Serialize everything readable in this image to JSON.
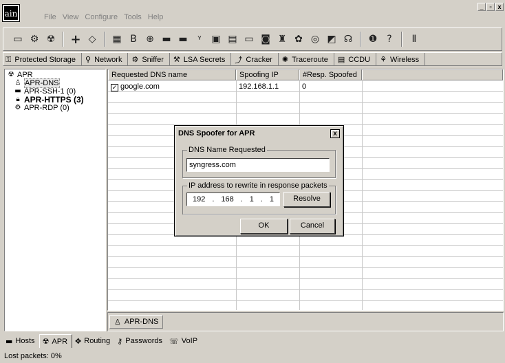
{
  "app": {
    "logo_text": "ain"
  },
  "menu": [
    "File",
    "View",
    "Configure",
    "Tools",
    "Help"
  ],
  "window_controls": [
    "_",
    "▫",
    "x"
  ],
  "toolbar": {
    "icons": [
      "open-icon",
      "sniffer-icon",
      "apr-icon",
      "add-icon",
      "hash-icon",
      "config-icon",
      "base64-icon",
      "dump-icon",
      "lsa-icon",
      "wireless-icon",
      "pwd-icon",
      "rsa-icon",
      "ntlm-icon",
      "keyboard-icon",
      "cd-icon",
      "vnc-icon",
      "dict-icon",
      "route-icon",
      "voip-icon",
      "about-icon",
      "help-icon",
      "exit-icon"
    ]
  },
  "tabs": [
    {
      "label": "Protected Storage",
      "icon": "vault-icon"
    },
    {
      "label": "Network",
      "icon": "network-icon"
    },
    {
      "label": "Sniffer",
      "icon": "sniffer-icon"
    },
    {
      "label": "LSA Secrets",
      "icon": "lsa-icon"
    },
    {
      "label": "Cracker",
      "icon": "cracker-icon"
    },
    {
      "label": "Traceroute",
      "icon": "traceroute-icon"
    },
    {
      "label": "CCDU",
      "icon": "ccdu-icon"
    },
    {
      "label": "Wireless",
      "icon": "wireless-icon"
    }
  ],
  "tree": {
    "root": "APR",
    "items": [
      {
        "label": "APR-DNS",
        "icon": "dns-icon"
      },
      {
        "label": "APR-SSH-1 (0)",
        "icon": "terminal-icon"
      },
      {
        "label": "APR-HTTPS (3)",
        "icon": "lock-icon"
      },
      {
        "label": "APR-RDP (0)",
        "icon": "rdp-icon"
      }
    ]
  },
  "table": {
    "columns": [
      "Requested DNS name",
      "Spoofing IP",
      "#Resp. Spoofed"
    ],
    "rows": [
      {
        "checked": true,
        "name": "google.com",
        "ip": "192.168.1.1",
        "count": "0"
      }
    ]
  },
  "subtab": {
    "label": "APR-DNS"
  },
  "module_tabs": [
    "Hosts",
    "APR",
    "Routing",
    "Passwords",
    "VoIP"
  ],
  "status": {
    "text": "Lost packets:  0%"
  },
  "dialog": {
    "title": "DNS Spoofer for APR",
    "close": "x",
    "group1_label": "DNS Name Requested",
    "dns_value": "syngress.com",
    "group2_label": "IP address to rewrite in response packets",
    "ip": [
      "192",
      "168",
      "1",
      "1"
    ],
    "resolve_label": "Resolve",
    "ok_label": "OK",
    "cancel_label": "Cancel"
  }
}
